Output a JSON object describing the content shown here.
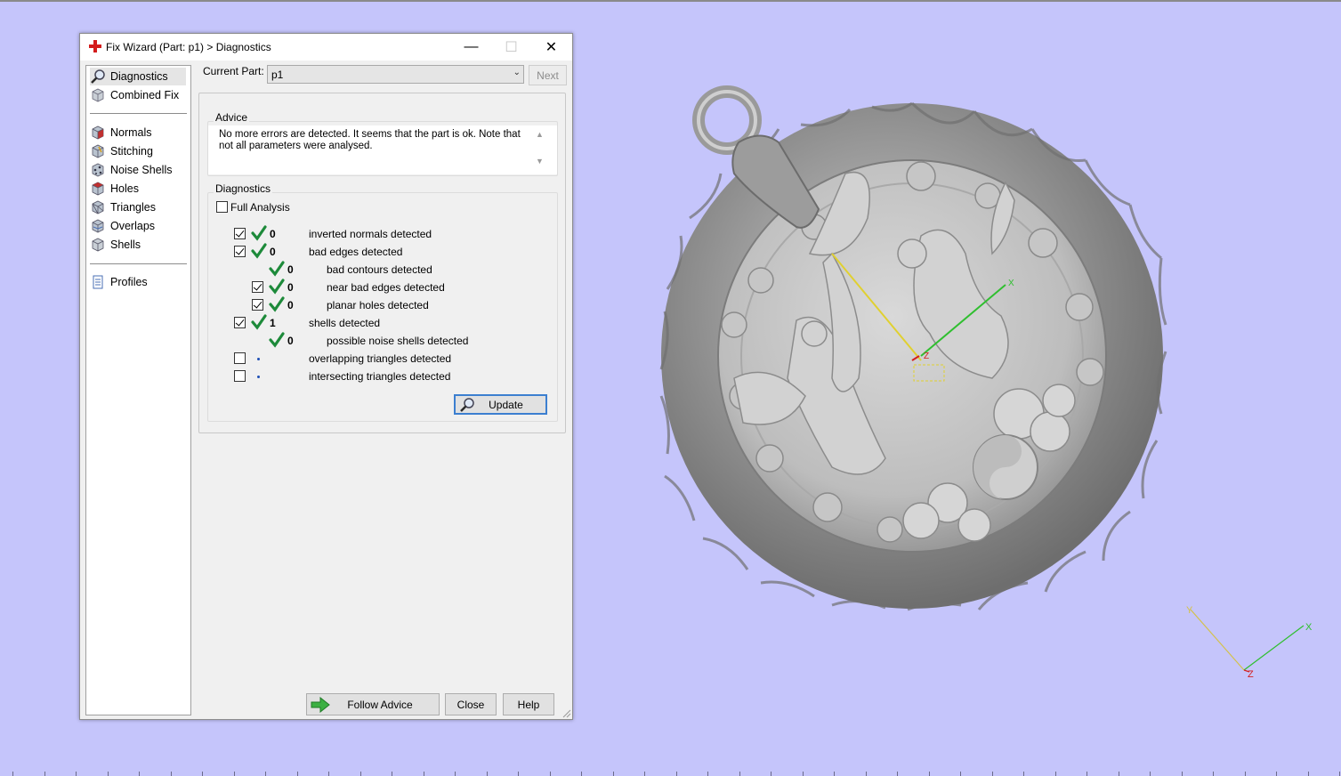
{
  "window": {
    "title": "Fix Wizard (Part: p1) > Diagnostics",
    "minimize_glyph": "—",
    "maximize_glyph": "☐",
    "close_glyph": "✕"
  },
  "nav": {
    "items": [
      {
        "label": "Diagnostics",
        "icon": "magnifier-icon",
        "selected": true
      },
      {
        "label": "Combined Fix",
        "icon": "cube-icon"
      },
      {
        "label": "Normals",
        "icon": "normals-cube-icon"
      },
      {
        "label": "Stitching",
        "icon": "stitching-cube-icon"
      },
      {
        "label": "Noise Shells",
        "icon": "noise-shells-icon"
      },
      {
        "label": "Holes",
        "icon": "holes-cube-icon"
      },
      {
        "label": "Triangles",
        "icon": "triangles-cube-icon"
      },
      {
        "label": "Overlaps",
        "icon": "overlaps-cube-icon"
      },
      {
        "label": "Shells",
        "icon": "shells-cube-icon"
      },
      {
        "label": "Profiles",
        "icon": "document-icon"
      }
    ]
  },
  "current_part": {
    "label": "Current Part:",
    "value": "p1",
    "next_label": "Next"
  },
  "advice": {
    "title": "Advice",
    "text": "No more errors are detected. It seems that the part is ok. Note that not all parameters were analysed."
  },
  "diagnostics": {
    "title": "Diagnostics",
    "full_analysis_label": "Full Analysis",
    "full_analysis_checked": false,
    "rows": [
      {
        "count": "0",
        "label": "inverted normals detected",
        "checked": true
      },
      {
        "count": "0",
        "label": "bad edges detected",
        "checked": true
      },
      {
        "count": "0",
        "label": "bad contours detected"
      },
      {
        "count": "0",
        "label": "near bad edges detected",
        "checked": true
      },
      {
        "count": "0",
        "label": "planar holes detected",
        "checked": true
      },
      {
        "count": "1",
        "label": "shells detected",
        "checked": true
      },
      {
        "count": "0",
        "label": "possible noise shells detected"
      },
      {
        "label": "overlapping triangles detected",
        "checked": false
      },
      {
        "label": "intersecting triangles detected",
        "checked": false
      }
    ],
    "update_label": "Update"
  },
  "footer": {
    "follow_advice_label": "Follow Advice",
    "close_label": "Close",
    "help_label": "Help"
  },
  "axes": {
    "model": {
      "x": "X",
      "z": "Z"
    },
    "corner": {
      "x": "X",
      "y": "Y",
      "z": "Z"
    }
  },
  "colors": {
    "viewport_bg": "#c5c5fb",
    "check_green": "#1d8a3a",
    "axis_x": "#2fbf2f",
    "axis_y": "#d4c24a",
    "axis_z": "#d42020"
  }
}
